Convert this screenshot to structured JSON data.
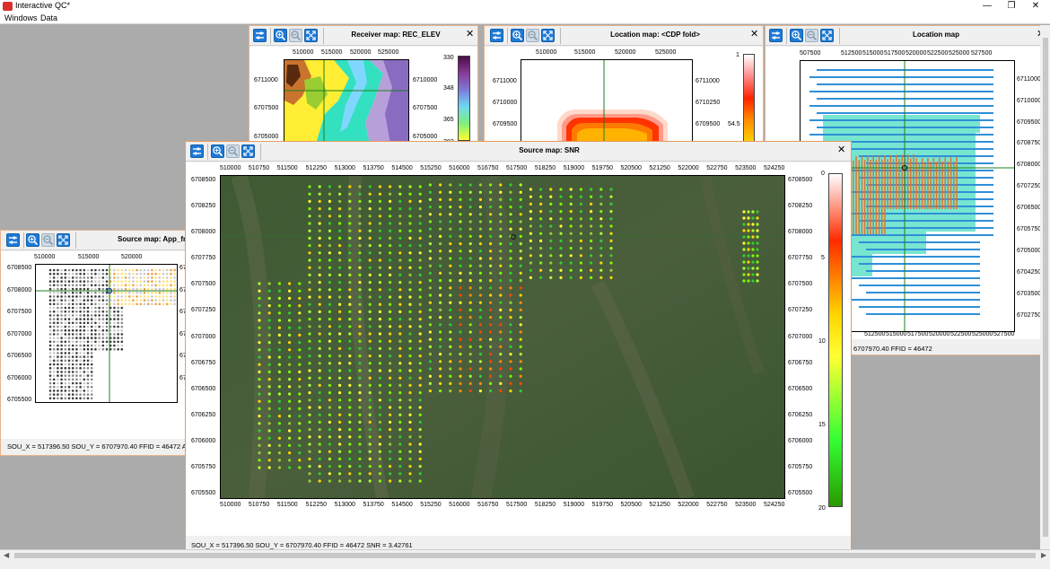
{
  "app": {
    "title": "Interactive QC*",
    "minimize_glyph": "—",
    "restore_glyph": "❐",
    "close_glyph": "✕",
    "menu": [
      "Windows",
      "Data"
    ],
    "scroll_left_glyph": "◀",
    "scroll_right_glyph": "▶"
  },
  "toolbar_icons": [
    "settings-icon",
    "zoom-in-icon",
    "zoom-out-icon",
    "fit-view-icon"
  ],
  "receiver_window": {
    "title": "Receiver map:  REC_ELEV",
    "close_glyph": "✕",
    "x_ticks": [
      "510000",
      "515000",
      "520000",
      "525000"
    ],
    "y_ticks_left": [
      "6711000",
      "6707500",
      "6705000"
    ],
    "y_ticks_right": [
      "6710000",
      "6707500",
      "6705000"
    ],
    "colorbar_ticks": [
      "330",
      "348",
      "365",
      "383"
    ]
  },
  "location_window": {
    "title": "Location map:  <CDP fold>",
    "close_glyph": "✕",
    "x_ticks": [
      "510000",
      "515000",
      "520000",
      "525000"
    ],
    "y_ticks_left": [
      "6711000",
      "6710000",
      "6709500"
    ],
    "y_ticks_right": [
      "6711000",
      "6710250",
      "6709500"
    ],
    "colorbar_ticks": [
      "1",
      "54.5"
    ]
  },
  "location_map_window": {
    "title": "Location map",
    "close_glyph": "✕",
    "x_ticks": [
      "507500",
      "512500",
      "515000",
      "517500",
      "520000",
      "522500",
      "525000",
      "527500"
    ],
    "x_ticks_bottom": [
      "512500",
      "515000",
      "517500",
      "520000",
      "522500",
      "525000",
      "527500"
    ],
    "y_ticks_right": [
      "6711000",
      "6710000",
      "6709500",
      "6708750",
      "6708000",
      "6707250",
      "6706500",
      "6705750",
      "6705000",
      "6704250",
      "6703500",
      "6702750"
    ],
    "status": "6707970.40 FFID = 46472"
  },
  "source_freq_window": {
    "title": "Source map:  App_fre",
    "x_ticks": [
      "510000",
      "515000",
      "520000"
    ],
    "y_ticks_left": [
      "6708000",
      "6707500",
      "6707000",
      "6706500",
      "6706000",
      "6705500"
    ],
    "y_ticks_right": [
      "67",
      "67",
      "67",
      "67",
      "67",
      "67"
    ],
    "y_tick_top_left": "6708500",
    "status": "SOU_X = 517396.50 SOU_Y = 6707970.40 FFID = 46472 App_freq"
  },
  "snr_window": {
    "title": "Source map:  SNR",
    "close_glyph": "✕",
    "x_ticks": [
      "510000",
      "510750",
      "511500",
      "512250",
      "513000",
      "513750",
      "514500",
      "515250",
      "516000",
      "516750",
      "517500",
      "518250",
      "519000",
      "519750",
      "520500",
      "521250",
      "522000",
      "522750",
      "523500",
      "524250"
    ],
    "y_ticks": [
      "6708500",
      "6708250",
      "6708000",
      "6707750",
      "6707500",
      "6707250",
      "6707000",
      "6706750",
      "6706500",
      "6706250",
      "6706000",
      "6705750",
      "6705500"
    ],
    "colorbar_ticks": [
      "0",
      "5",
      "10",
      "15",
      "20"
    ],
    "status": "SOU_X = 517396.50 SOU_Y = 6707970.40 FFID = 46472 SNR = 3.42761",
    "colorbar_colors": [
      "#ffffff",
      "#ff2a00",
      "#ffd400",
      "#ffff33",
      "#33ff33",
      "#2a9900"
    ]
  }
}
